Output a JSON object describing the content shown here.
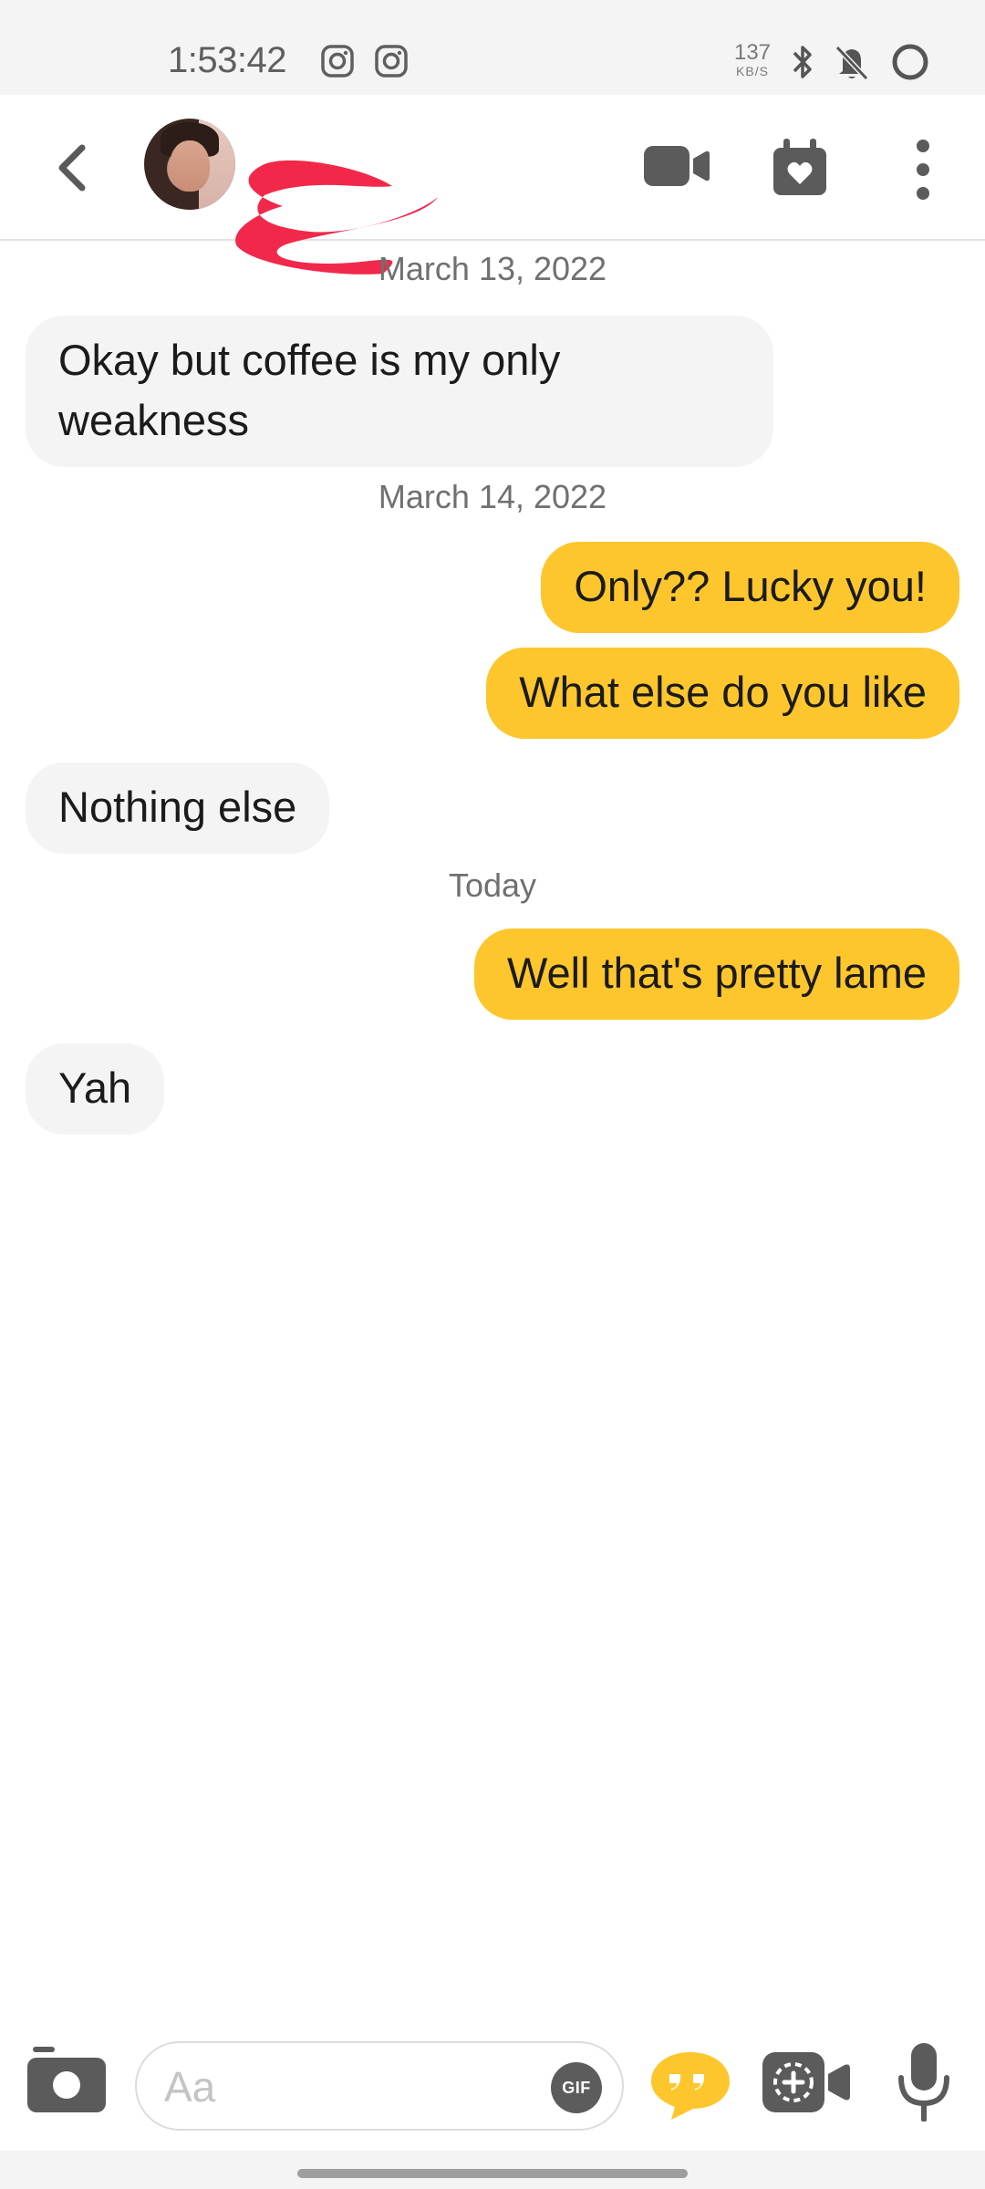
{
  "status_bar": {
    "time": "1:53:42",
    "network_speed_value": "137",
    "network_speed_unit": "KB/S",
    "icons": [
      "instagram-icon",
      "instagram-icon",
      "bluetooth-icon",
      "bell-off-icon",
      "battery-ring-icon"
    ]
  },
  "header": {
    "back_icon": "chevron-left-icon",
    "contact_name_redacted": true,
    "actions": [
      "video-call-icon",
      "calendar-heart-icon",
      "more-vertical-icon"
    ]
  },
  "conversation": {
    "dates": [
      "March 13, 2022",
      "March 14, 2022",
      "Today"
    ],
    "messages": [
      {
        "direction": "in",
        "text": "Okay but coffee is my only weakness"
      },
      {
        "direction": "out",
        "text": "Only?? Lucky you!"
      },
      {
        "direction": "out",
        "text": "What else do you like"
      },
      {
        "direction": "in",
        "text": "Nothing else"
      },
      {
        "direction": "out",
        "text": "Well that's pretty lame"
      },
      {
        "direction": "in",
        "text": "Yah"
      }
    ]
  },
  "composer": {
    "placeholder": "Aa",
    "value": "",
    "gif_label": "GIF",
    "icons": [
      "camera-icon",
      "quote-icon",
      "video-note-icon",
      "microphone-icon"
    ]
  },
  "colors": {
    "accent": "#fdc62d",
    "incoming_bubble": "#f4f4f4",
    "redaction": "#f2284a"
  }
}
